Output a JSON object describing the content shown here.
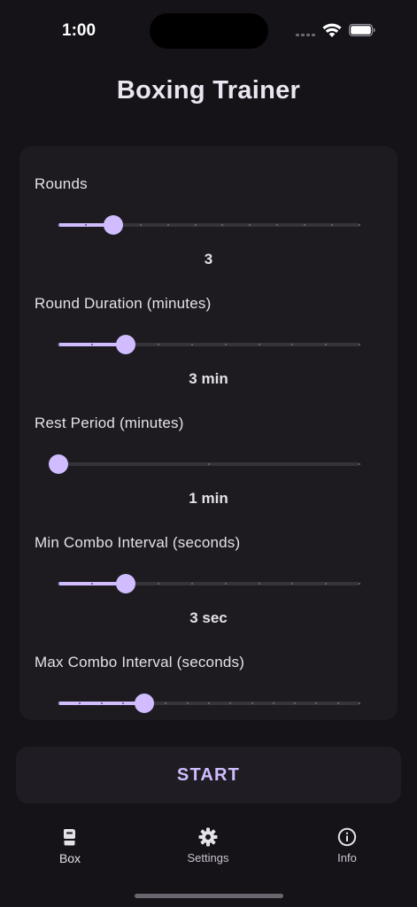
{
  "status_bar": {
    "time": "1:00"
  },
  "app": {
    "title": "Boxing Trainer"
  },
  "settings": [
    {
      "label": "Rounds",
      "value_text": "3",
      "value": 3,
      "min": 1,
      "max": 12,
      "divisions": 11
    },
    {
      "label": "Round Duration (minutes)",
      "value_text": "3 min",
      "value": 3,
      "min": 1,
      "max": 10,
      "divisions": 9
    },
    {
      "label": "Rest Period (minutes)",
      "value_text": "1 min",
      "value": 1,
      "min": 1,
      "max": 3,
      "divisions": 2
    },
    {
      "label": "Min Combo Interval (seconds)",
      "value_text": "3 sec",
      "value": 3,
      "min": 1,
      "max": 10,
      "divisions": 9
    },
    {
      "label": "Max Combo Interval (seconds)",
      "value_text": "",
      "value": 5,
      "min": 1,
      "max": 15,
      "divisions": 14
    }
  ],
  "start_button": {
    "label": "START"
  },
  "nav": {
    "items": [
      {
        "label": "Box",
        "icon": "boxing-glove-icon",
        "active": true
      },
      {
        "label": "Settings",
        "icon": "gear-icon",
        "active": false
      },
      {
        "label": "Info",
        "icon": "info-icon",
        "active": false
      }
    ]
  },
  "colors": {
    "background": "#151218",
    "surface": "#1d1b20",
    "accent": "#d0bcff",
    "text": "#e6e0e9"
  }
}
